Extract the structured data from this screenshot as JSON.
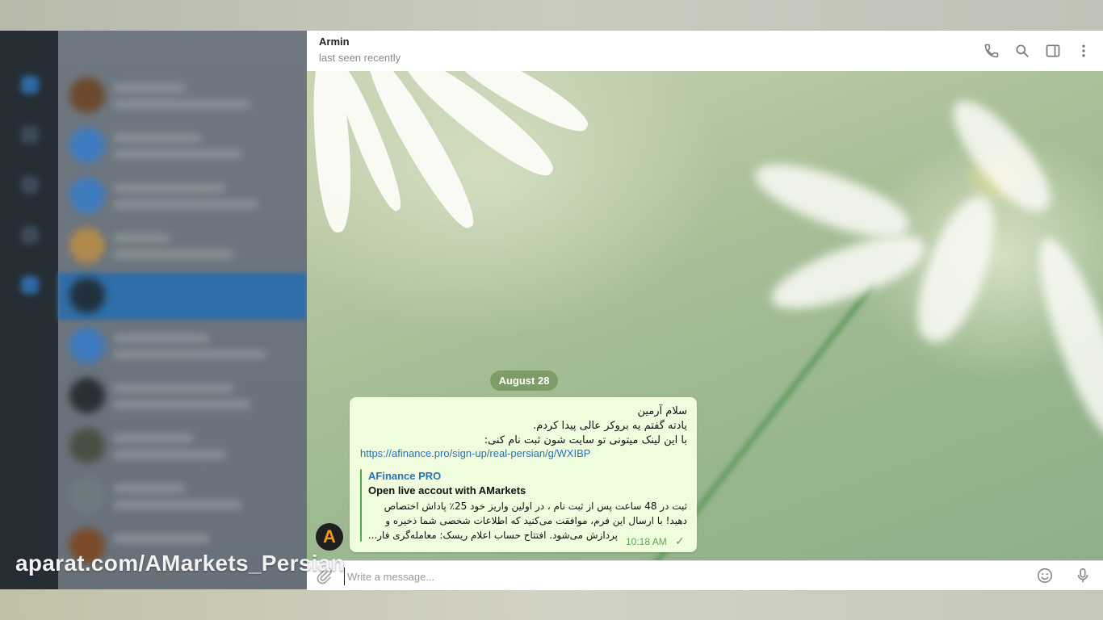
{
  "chat": {
    "contact_name": "Armin",
    "contact_status": "last seen recently",
    "header_icons": [
      "phone-icon",
      "search-icon",
      "sidebar-toggle-icon",
      "more-vertical-icon"
    ],
    "date_separator": "August 28",
    "message": {
      "lines": [
        "سلام آرمین",
        "یادته گفتم یه بروکر عالی پیدا کردم.",
        "با این لینک میتونی تو سایت شون  ثبت نام کنی:"
      ],
      "link": "https://afinance.pro/sign-up/real-persian/g/WXIBP",
      "preview": {
        "site_name": "AFinance PRO",
        "title": "Open live accout with AMarkets",
        "description_lines": [
          "ثبت در 48 ساعت پس از ثبت نام ، در اولین واریز خود 25٪ پاداش اختصاص",
          "دهید! با ارسال این فرم، موافقت می‌کنید که اطلاعات شخصی شما ذخیره و",
          "پردازش می‌شود. افتتاح حساب اعلام ریسک: معامله‌گری فار..."
        ]
      },
      "time": "10:18 AM",
      "status_icon": "check-icon"
    },
    "sender_avatar_letter": "A",
    "composer": {
      "placeholder": "Write a message...",
      "icons": [
        "attach-icon",
        "emoji-icon",
        "microphone-icon"
      ]
    }
  },
  "watermark": "aparat.com/AMarkets_Persian",
  "colors": {
    "bubble": "#effdde",
    "link": "#2a71b8",
    "accent_green": "#5fa25a",
    "avatar_letter": "#f39a14"
  }
}
